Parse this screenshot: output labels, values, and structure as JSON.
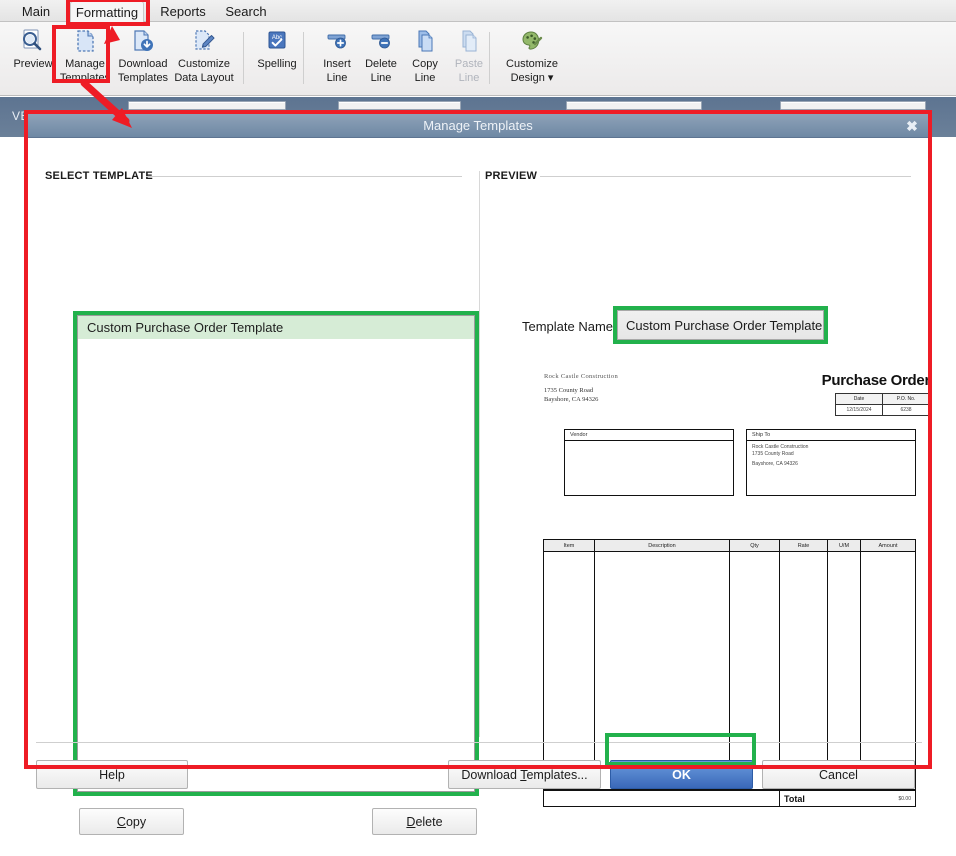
{
  "ribbon": {
    "tabs": [
      {
        "id": "main",
        "label": "Main",
        "active": false
      },
      {
        "id": "formatting",
        "label": "Formatting",
        "active": true
      },
      {
        "id": "reports",
        "label": "Reports",
        "active": false
      },
      {
        "id": "search",
        "label": "Search",
        "active": false
      }
    ],
    "buttons": [
      {
        "id": "preview",
        "line1": "Preview",
        "line2": "",
        "icon": "magnifier-page-icon",
        "disabled": false
      },
      {
        "id": "manage-templates",
        "line1": "Manage",
        "line2": "Templates",
        "icon": "document-dashed-icon",
        "disabled": false
      },
      {
        "id": "download-templates",
        "line1": "Download",
        "line2": "Templates",
        "icon": "document-download-icon",
        "disabled": false
      },
      {
        "id": "customize-data-layout",
        "line1": "Customize",
        "line2": "Data Layout",
        "icon": "document-pencil-icon",
        "disabled": false
      },
      {
        "id": "spelling",
        "line1": "Spelling",
        "line2": "",
        "icon": "abc-check-icon",
        "disabled": false
      },
      {
        "id": "insert-line",
        "line1": "Insert",
        "line2": "Line",
        "icon": "line-plus-icon",
        "disabled": false
      },
      {
        "id": "delete-line",
        "line1": "Delete",
        "line2": "Line",
        "icon": "line-minus-icon",
        "disabled": false
      },
      {
        "id": "copy-line",
        "line1": "Copy",
        "line2": "Line",
        "icon": "copy-pages-icon",
        "disabled": false
      },
      {
        "id": "paste-line",
        "line1": "Paste",
        "line2": "Line",
        "icon": "paste-pages-icon",
        "disabled": true
      },
      {
        "id": "customize-design",
        "line1": "Customize",
        "line2": "Design ▾",
        "icon": "palette-brush-icon",
        "disabled": false
      }
    ]
  },
  "background_form": {
    "label": "VE"
  },
  "dialog": {
    "title": "Manage Templates",
    "close_label": "✖",
    "select_template": {
      "heading": "SELECT TEMPLATE",
      "items": [
        {
          "label": "Custom Purchase Order Template",
          "selected": true
        }
      ],
      "copy_button": {
        "pre": "",
        "acc": "C",
        "post": "opy"
      },
      "delete_button": {
        "pre": "",
        "acc": "D",
        "post": "elete"
      }
    },
    "preview": {
      "heading": "PREVIEW",
      "template_name_label": "Template Name",
      "template_name_value": "Custom Purchase Order Template",
      "document": {
        "company_name": "Rock Castle Construction",
        "address_line1": "1735 County Road",
        "address_line2": "Bayshore, CA 94326",
        "doc_title": "Purchase Order",
        "meta_headers": [
          "Date",
          "P.O. No."
        ],
        "meta_values": [
          "12/15/2024",
          "6238"
        ],
        "vendor_box": {
          "title": "Vendor",
          "lines": []
        },
        "shipto_box": {
          "title": "Ship To",
          "lines": [
            "Rock Castle Construction",
            "1735 County Road",
            "Bayshore, CA 94326"
          ]
        },
        "item_columns": [
          "Item",
          "Description",
          "Qty",
          "Rate",
          "U/M",
          "Amount"
        ],
        "item_rows": [],
        "total_label": "Total",
        "total_value": "$0.00"
      }
    },
    "footer": {
      "help": {
        "pre": "Help",
        "acc": "",
        "post": ""
      },
      "download_templates": {
        "pre": "Download ",
        "acc": "T",
        "post": "emplates..."
      },
      "ok": {
        "pre": "OK",
        "acc": "",
        "post": ""
      },
      "cancel": {
        "pre": "Cancel",
        "acc": "",
        "post": ""
      }
    }
  },
  "annotations": {
    "highlight_color": "#ee1c25",
    "select_color": "#22b14c",
    "boxes": [
      "formatting-tab",
      "manage-templates-button",
      "manage-templates-dialog"
    ],
    "green_boxes": [
      "template-list",
      "template-name-field",
      "ok-button"
    ]
  }
}
